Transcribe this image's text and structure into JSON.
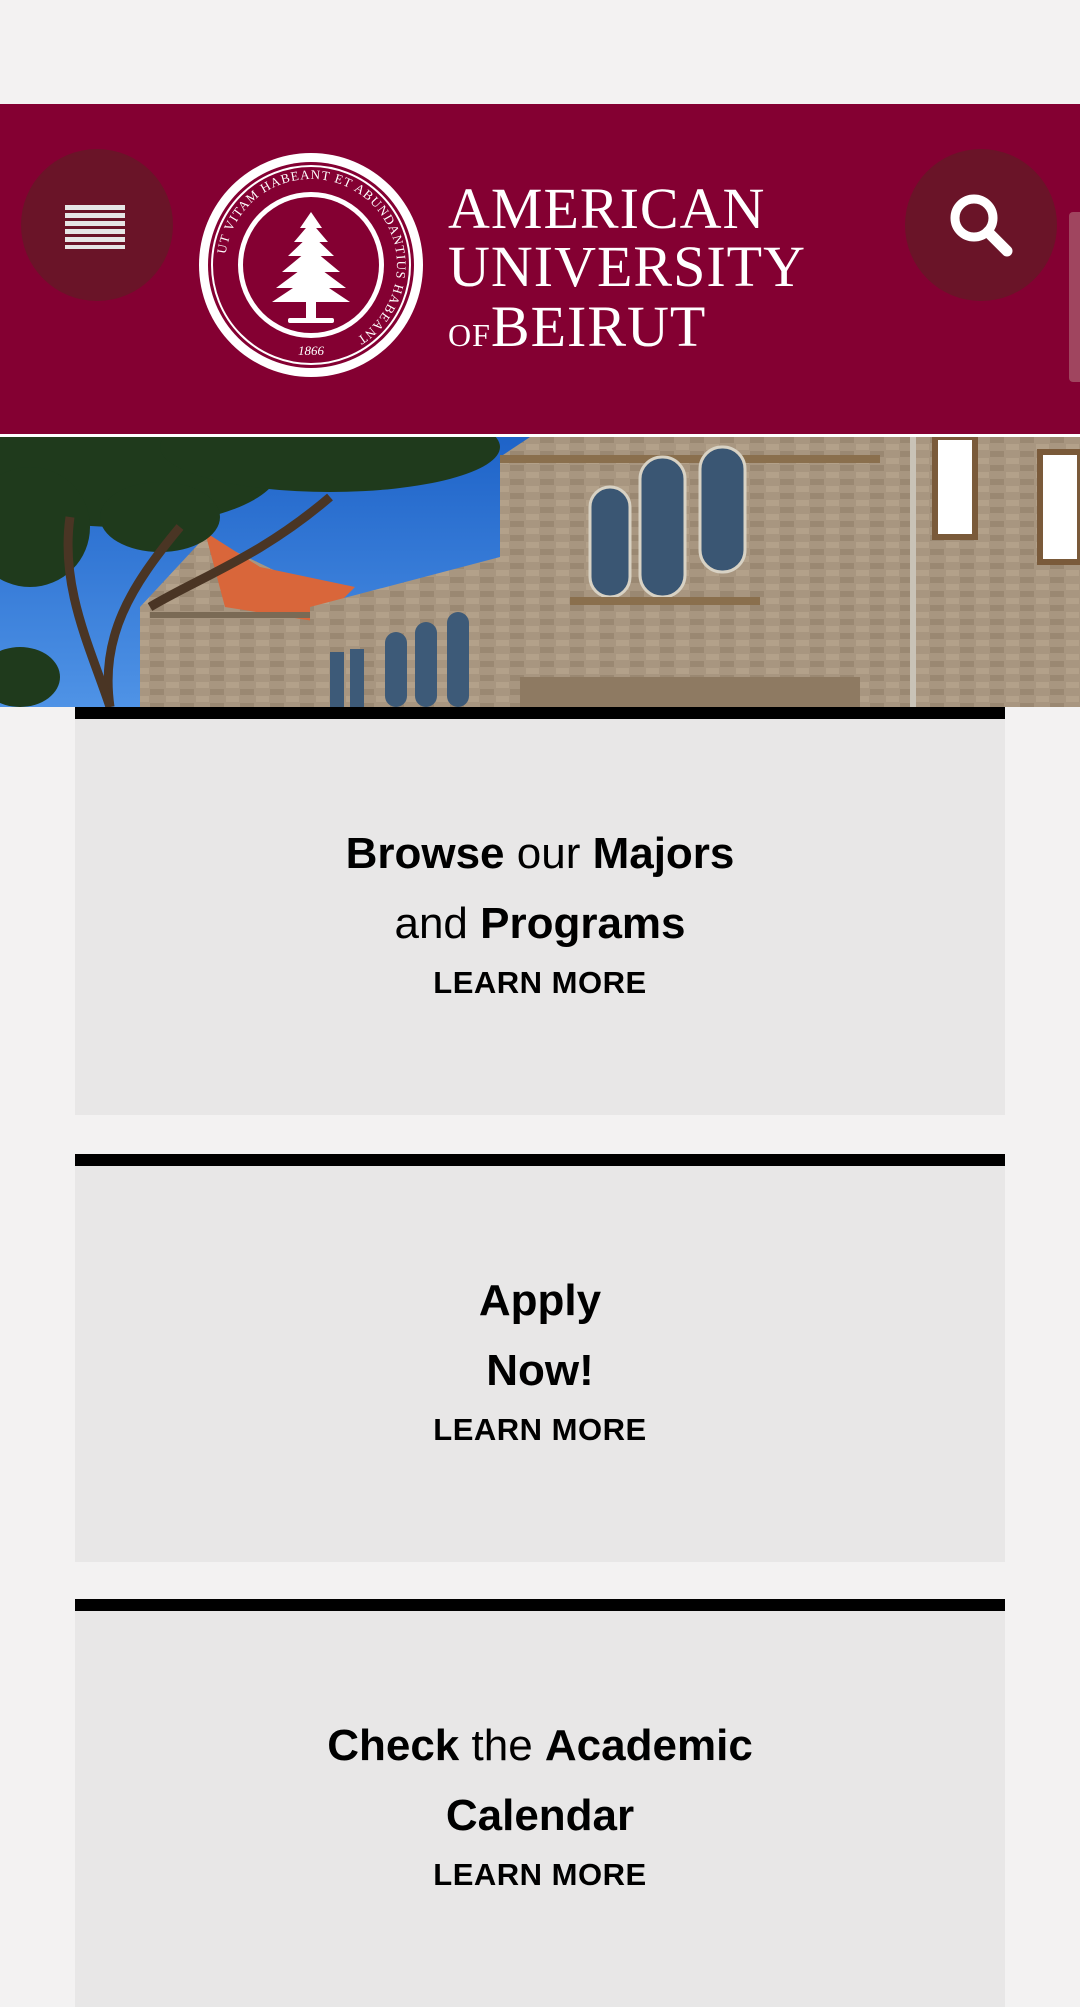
{
  "header": {
    "menu_icon": "hamburger-menu-icon",
    "search_icon": "search-icon",
    "logo": {
      "seal_motto": "UT VITAM HABEANT ET ABUNDANTIUS HABEANT",
      "seal_year": "1866",
      "line1": "AMERICAN",
      "line2": "UNIVERSITY",
      "line3_small": "OF",
      "line3": "BEIRUT"
    },
    "colors": {
      "primary": "#840032",
      "button": "#6a1428"
    }
  },
  "cards": [
    {
      "title_line1": [
        {
          "text": "Browse",
          "bold": true
        },
        {
          "text": " our ",
          "bold": false
        },
        {
          "text": "Majors",
          "bold": true
        }
      ],
      "title_line2": [
        {
          "text": "and ",
          "bold": false
        },
        {
          "text": "Programs",
          "bold": true
        }
      ],
      "link": "LEARN MORE"
    },
    {
      "title_line1": [
        {
          "text": "Apply",
          "bold": true
        }
      ],
      "title_line2": [
        {
          "text": "Now!",
          "bold": true
        }
      ],
      "link": "LEARN MORE"
    },
    {
      "title_line1": [
        {
          "text": "Check",
          "bold": true
        },
        {
          "text": " the ",
          "bold": false
        },
        {
          "text": "Academic",
          "bold": true
        }
      ],
      "title_line2": [
        {
          "text": "Calendar",
          "bold": true
        }
      ],
      "link": "LEARN MORE"
    }
  ]
}
